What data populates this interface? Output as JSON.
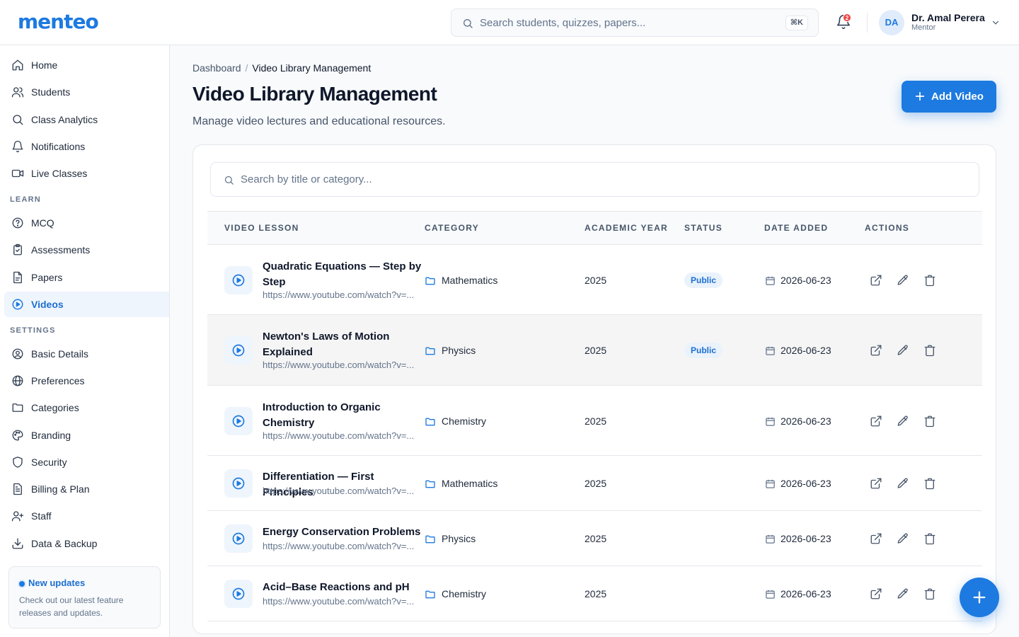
{
  "app": {
    "logo": "menteo"
  },
  "header": {
    "search_placeholder": "Search students, quizzes, papers...",
    "search_shortcut": "⌘K",
    "notifications_count": "2",
    "user": {
      "initials": "DA",
      "name": "Dr. Amal Perera",
      "role": "Mentor"
    }
  },
  "sidebar": {
    "main_items": [
      {
        "label": "Home",
        "icon": "home-icon"
      },
      {
        "label": "Students",
        "icon": "users-icon"
      },
      {
        "label": "Class Analytics",
        "icon": "search-icon"
      },
      {
        "label": "Notifications",
        "icon": "bell-icon"
      },
      {
        "label": "Live Classes",
        "icon": "video-camera-icon"
      }
    ],
    "learn_label": "LEARN",
    "learn_items": [
      {
        "label": "MCQ",
        "icon": "question-circle-icon"
      },
      {
        "label": "Assessments",
        "icon": "clipboard-check-icon"
      },
      {
        "label": "Papers",
        "icon": "document-icon"
      },
      {
        "label": "Videos",
        "icon": "play-circle-icon",
        "active": true
      }
    ],
    "settings_label": "SETTINGS",
    "settings_items": [
      {
        "label": "Basic Details",
        "icon": "user-circle-icon"
      },
      {
        "label": "Preferences",
        "icon": "globe-icon"
      },
      {
        "label": "Categories",
        "icon": "folder-icon"
      },
      {
        "label": "Branding",
        "icon": "palette-icon"
      },
      {
        "label": "Security",
        "icon": "shield-icon"
      },
      {
        "label": "Billing & Plan",
        "icon": "receipt-icon"
      },
      {
        "label": "Staff",
        "icon": "user-plus-icon"
      },
      {
        "label": "Data & Backup",
        "icon": "download-icon"
      }
    ],
    "updates": {
      "title": "New updates",
      "text": "Check out our latest feature releases and updates."
    }
  },
  "main": {
    "breadcrumb": {
      "root": "Dashboard",
      "current": "Video Library Management"
    },
    "title": "Video Library Management",
    "subtitle": "Manage video lectures and educational resources.",
    "add_button": "Add Video",
    "table_search_placeholder": "Search by title or category...",
    "columns": [
      "VIDEO LESSON",
      "CATEGORY",
      "ACADEMIC YEAR",
      "STATUS",
      "DATE ADDED",
      "ACTIONS"
    ],
    "rows": [
      {
        "title": "Quadratic Equations — Step by Step",
        "url": "https://www.youtube.com/watch?v=...",
        "category": "Mathematics",
        "year": "2025",
        "status": "Public",
        "date": "2026-06-23"
      },
      {
        "title": "Newton's Laws of Motion Explained",
        "url": "https://www.youtube.com/watch?v=...",
        "category": "Physics",
        "year": "2025",
        "status": "Public",
        "date": "2026-06-23"
      },
      {
        "title": "Introduction to Organic Chemistry",
        "url": "https://www.youtube.com/watch?v=...",
        "category": "Chemistry",
        "year": "2025",
        "status": "",
        "date": "2026-06-23"
      },
      {
        "title": "Differentiation — First Principles",
        "url": "https://www.youtube.com/watch?v=...",
        "category": "Mathematics",
        "year": "2025",
        "status": "",
        "date": "2026-06-23"
      },
      {
        "title": "Energy Conservation Problems",
        "url": "https://www.youtube.com/watch?v=...",
        "category": "Physics",
        "year": "2025",
        "status": "",
        "date": "2026-06-23"
      },
      {
        "title": "Acid–Base Reactions and pH",
        "url": "https://www.youtube.com/watch?v=...",
        "category": "Chemistry",
        "year": "2025",
        "status": "",
        "date": "2026-06-23"
      }
    ]
  },
  "colors": {
    "accent": "#1d7ae0",
    "active_bg": "#eff5fd",
    "badge_bg": "#eaf2fc",
    "danger": "#ef4444"
  }
}
